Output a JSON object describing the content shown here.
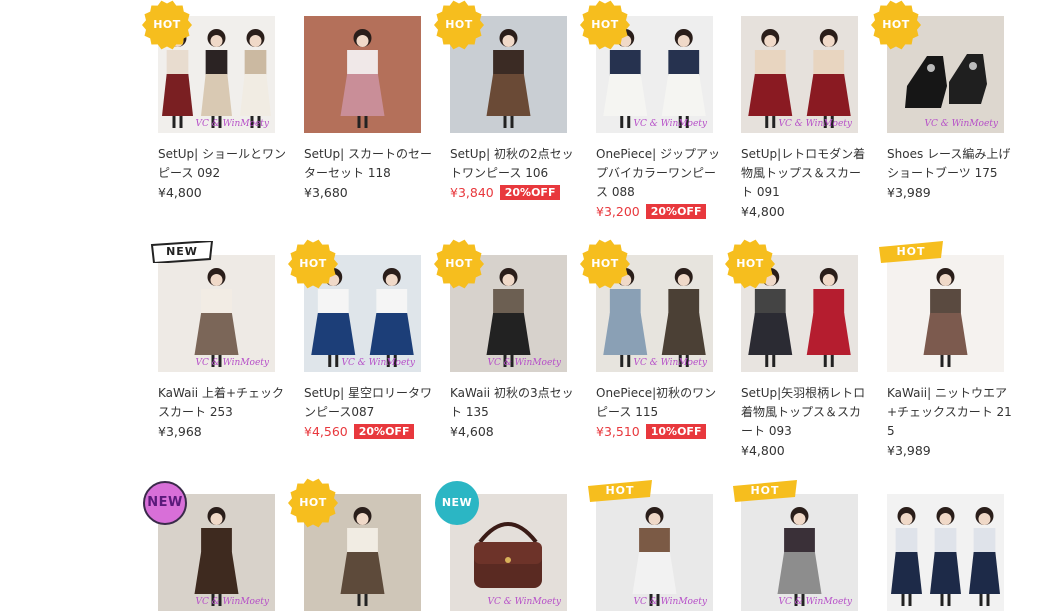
{
  "products": [
    {
      "name": "SetUp| ショールとワンピース 092",
      "price": "¥4,800",
      "sale": false,
      "off": "",
      "badge": "HOT",
      "badge_style": "burst",
      "watermark": "VC & WinMoety"
    },
    {
      "name": "SetUp| スカートのセーターセット 118",
      "price": "¥3,680",
      "sale": false,
      "off": "",
      "badge": "",
      "badge_style": "",
      "watermark": ""
    },
    {
      "name": "SetUp| 初秋の2点セットワンピース 106",
      "price": "¥3,840",
      "sale": true,
      "off": "20%OFF",
      "badge": "HOT",
      "badge_style": "burst",
      "watermark": ""
    },
    {
      "name": "OnePiece| ジップアップバイカラーワンピース 088",
      "price": "¥3,200",
      "sale": true,
      "off": "20%OFF",
      "badge": "HOT",
      "badge_style": "burst",
      "watermark": "VC & WinMoety"
    },
    {
      "name": "SetUp|レトロモダン着物風トップス＆スカート 091",
      "price": "¥4,800",
      "sale": false,
      "off": "",
      "badge": "",
      "badge_style": "",
      "watermark": "VC & WinMoety"
    },
    {
      "name": "Shoes レース編み上げショートブーツ 175",
      "price": "¥3,989",
      "sale": false,
      "off": "",
      "badge": "HOT",
      "badge_style": "burst",
      "watermark": "VC & WinMoety"
    },
    {
      "name": "KaWaii 上着+チェックスカート 253",
      "price": "¥3,968",
      "sale": false,
      "off": "",
      "badge": "NEW",
      "badge_style": "ribbon-new",
      "watermark": "VC & WinMoety"
    },
    {
      "name": "SetUp| 星空ロリータワンピース087",
      "price": "¥4,560",
      "sale": true,
      "off": "20%OFF",
      "badge": "HOT",
      "badge_style": "burst",
      "watermark": "VC & WinMoety"
    },
    {
      "name": "KaWaii 初秋の3点セット 135",
      "price": "¥4,608",
      "sale": false,
      "off": "",
      "badge": "HOT",
      "badge_style": "burst",
      "watermark": "VC & WinMoety"
    },
    {
      "name": "OnePiece|初秋のワンピース 115",
      "price": "¥3,510",
      "sale": true,
      "off": "10%OFF",
      "badge": "HOT",
      "badge_style": "burst",
      "watermark": "VC & WinMoety"
    },
    {
      "name": "SetUp|矢羽根柄レトロ着物風トップス＆スカート 093",
      "price": "¥4,800",
      "sale": false,
      "off": "",
      "badge": "HOT",
      "badge_style": "burst",
      "watermark": ""
    },
    {
      "name": "KaWaii| ニットウエア+チェックスカート 215",
      "price": "¥3,989",
      "sale": false,
      "off": "",
      "badge": "HOT",
      "badge_style": "ribbon-hot",
      "watermark": ""
    },
    {
      "name": "",
      "price": "",
      "sale": false,
      "off": "",
      "badge": "NEW",
      "badge_style": "circle-pink",
      "watermark": "VC & WinMoety"
    },
    {
      "name": "",
      "price": "",
      "sale": false,
      "off": "",
      "badge": "HOT",
      "badge_style": "burst",
      "watermark": ""
    },
    {
      "name": "",
      "price": "",
      "sale": false,
      "off": "",
      "badge": "NEW",
      "badge_style": "circle-teal",
      "watermark": "VC & WinMoety"
    },
    {
      "name": "",
      "price": "",
      "sale": false,
      "off": "",
      "badge": "HOT",
      "badge_style": "ribbon-hot",
      "watermark": "VC & WinMoety"
    },
    {
      "name": "",
      "price": "",
      "sale": false,
      "off": "",
      "badge": "HOT",
      "badge_style": "ribbon-hot",
      "watermark": "VC & WinMoety"
    },
    {
      "name": "",
      "price": "",
      "sale": false,
      "off": "",
      "badge": "",
      "badge_style": "",
      "watermark": ""
    }
  ],
  "colors": {
    "sale_red": "#e8383d",
    "hot_yellow": "#f6be1e",
    "new_teal": "#2bb6c4",
    "new_pink": "#d86fd8",
    "text": "#333333"
  }
}
